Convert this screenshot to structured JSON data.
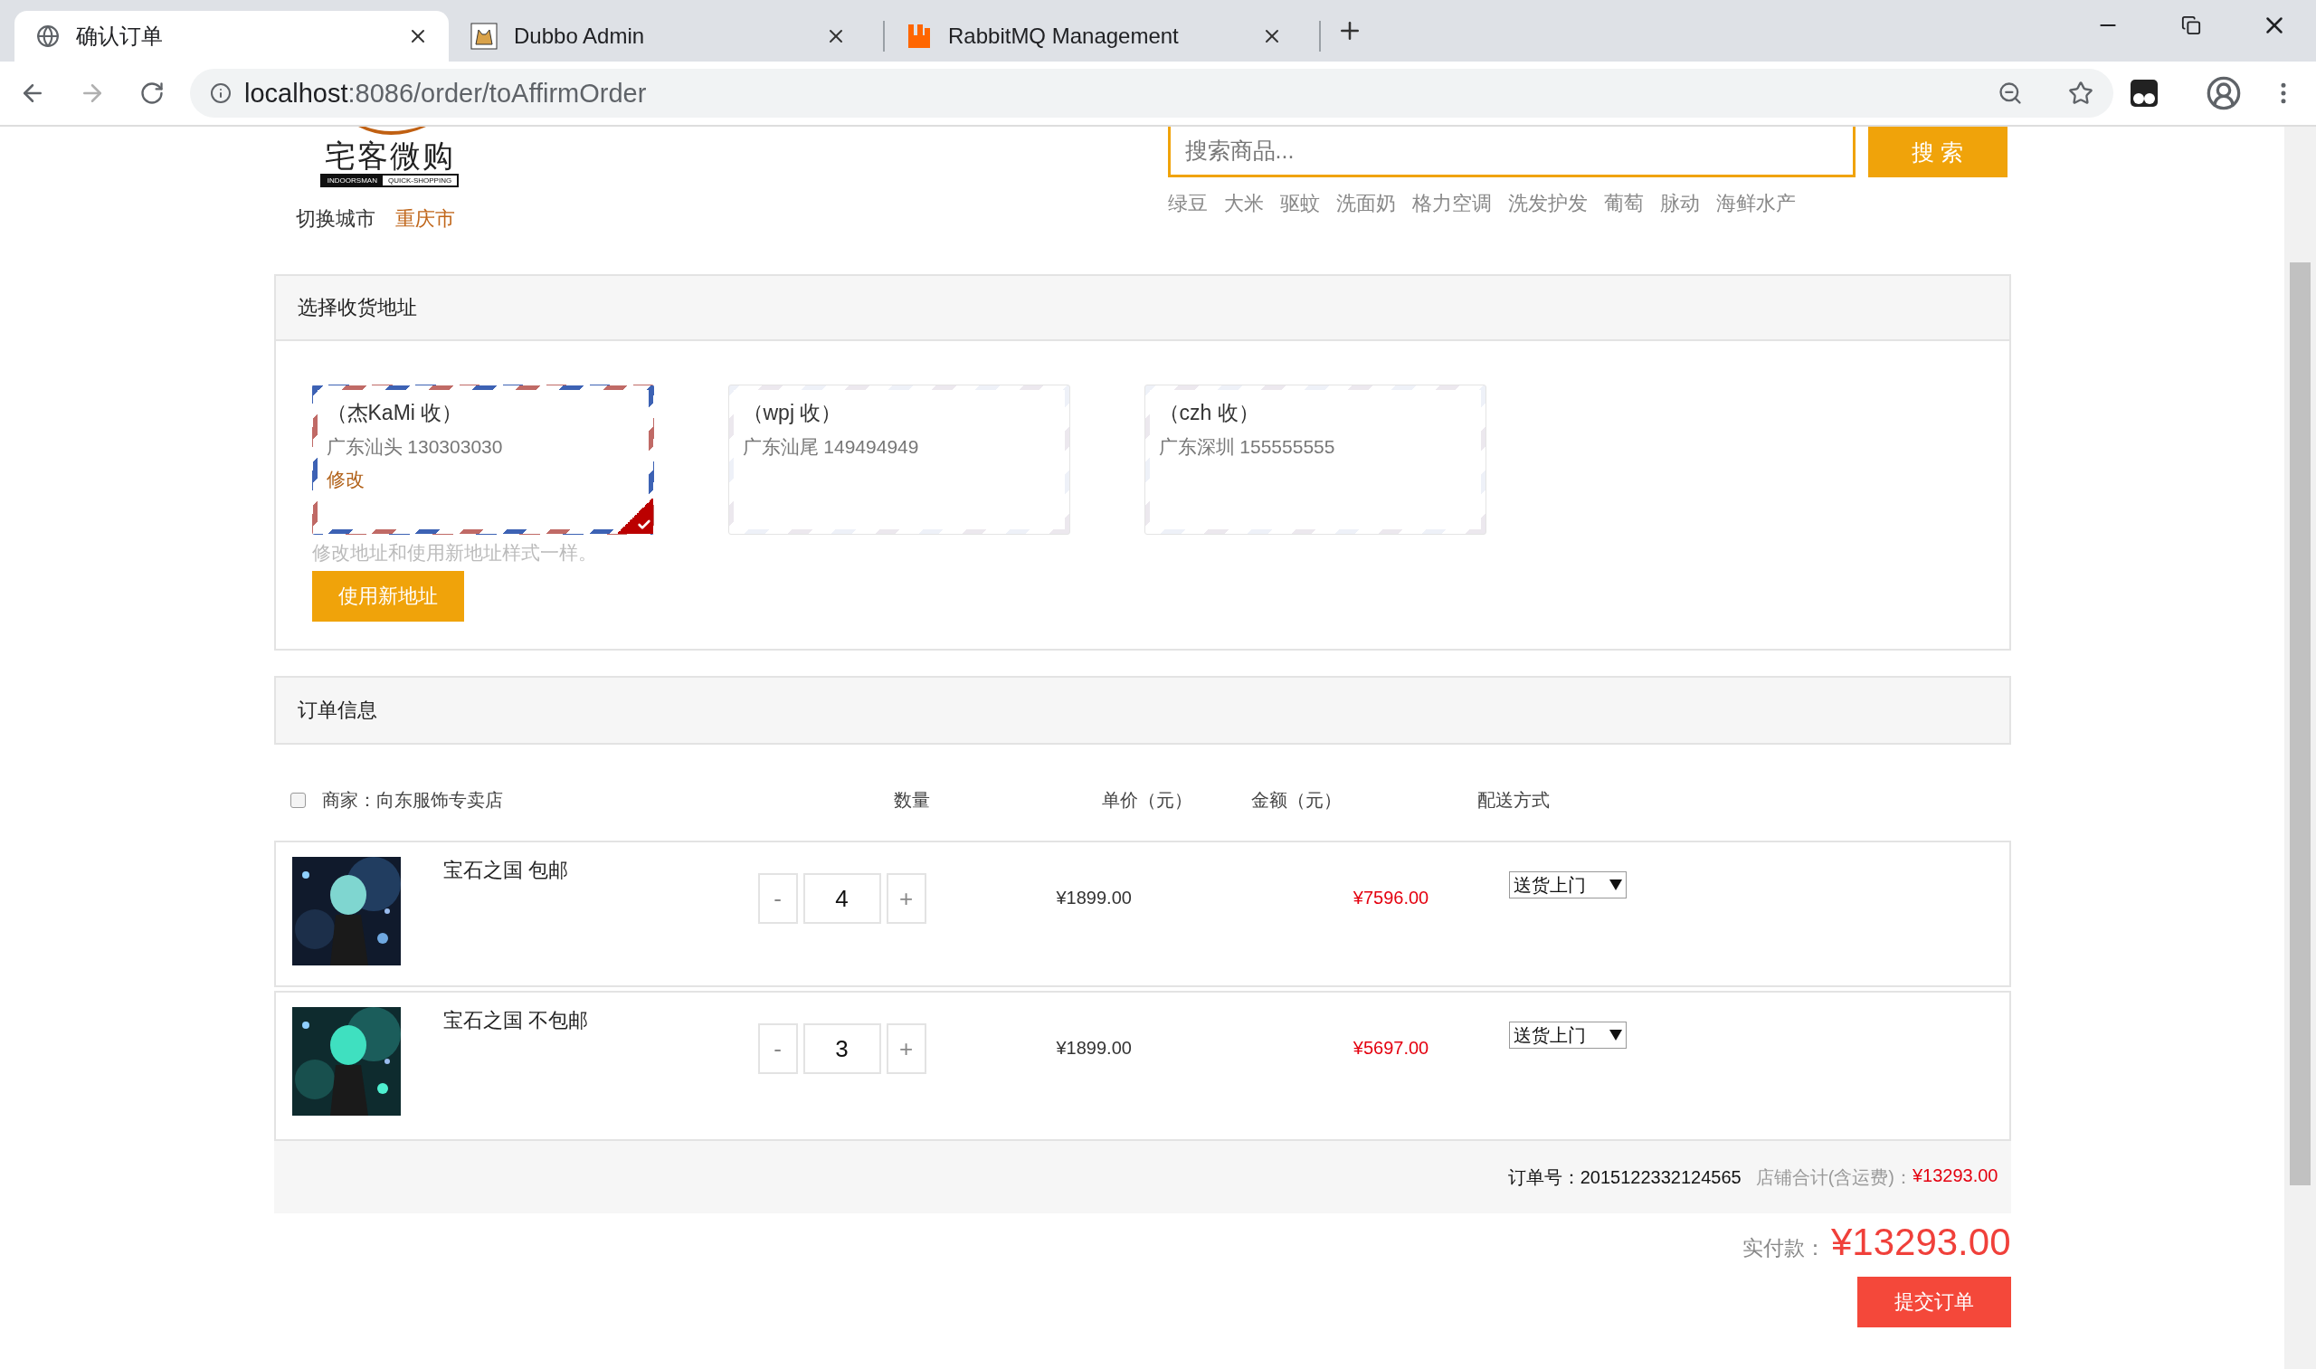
{
  "browser": {
    "tabs": [
      {
        "kind": "globe",
        "title": "确认订单",
        "selected": true
      },
      {
        "kind": "cat",
        "title": "Dubbo Admin",
        "selected": false
      },
      {
        "kind": "rabbit",
        "title": "RabbitMQ Management",
        "selected": false
      }
    ],
    "url_host": "localhost",
    "url_path": ":8086/order/toAffirmOrder"
  },
  "header": {
    "logo": {
      "title": "宅客微购",
      "tag_left": "INDOORSMAN",
      "tag_right": "QUICK-SHOPPING"
    },
    "city_label": "切换城市",
    "city": "重庆市",
    "search": {
      "placeholder": "搜索商品...",
      "button": "搜 索"
    },
    "hot_words": [
      "绿豆",
      "大米",
      "驱蚊",
      "洗面奶",
      "格力空调",
      "洗发护发",
      "葡萄",
      "脉动",
      "海鲜水产"
    ]
  },
  "address": {
    "title": "选择收货地址",
    "cards": [
      {
        "name": "（杰KaMi 收）",
        "detail": "广东汕头 130303030",
        "edit": "修改",
        "selected": true
      },
      {
        "name": "（wpj 收）",
        "detail": "广东汕尾 149494949",
        "selected": false
      },
      {
        "name": "（czh 收）",
        "detail": "广东深圳 155555555",
        "selected": false
      }
    ],
    "hint": "修改地址和使用新地址样式一样。",
    "new_button": "使用新地址"
  },
  "order": {
    "title": "订单信息",
    "merchant": {
      "checked": false,
      "label": "商家：向东服饰专卖店"
    },
    "columns": [
      "数量",
      "单价（元）",
      "金额（元）",
      "配送方式"
    ],
    "items": [
      {
        "name": "宝石之国 包邮",
        "quantity": "4",
        "price": "¥1899.00",
        "amount": "¥7596.00",
        "delivery": "送货上门",
        "minus": "-",
        "plus": "+"
      },
      {
        "name": "宝石之国 不包邮",
        "quantity": "3",
        "price": "¥1899.00",
        "amount": "¥5697.00",
        "delivery": "送货上门",
        "minus": "-",
        "plus": "+"
      }
    ],
    "order_no_label": "订单号：",
    "order_no": "2015122332124565",
    "shop_total_label": "店铺合计(含运费)：",
    "shop_total": "¥13293.00",
    "pay_label": "实付款：",
    "pay_total": "¥13293.00",
    "submit": "提交订单"
  }
}
